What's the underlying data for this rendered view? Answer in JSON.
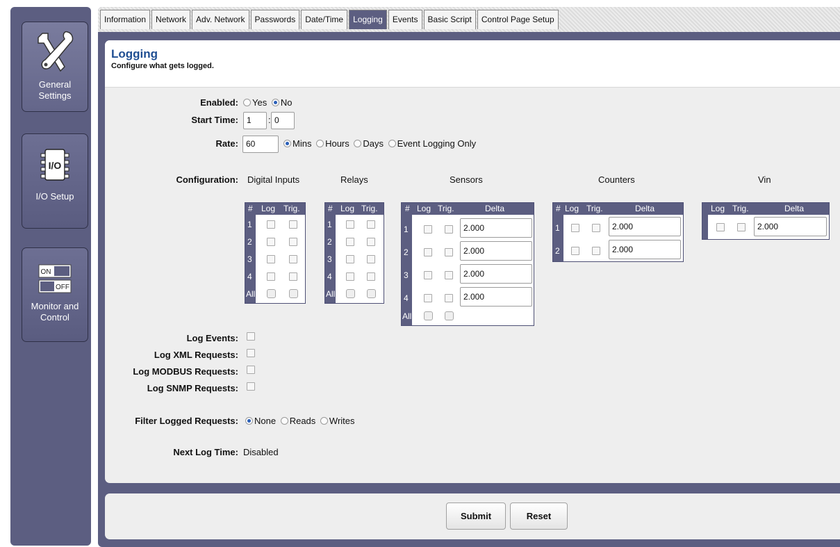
{
  "sidebar": {
    "items": [
      {
        "label_1": "General",
        "label_2": "Settings",
        "icon": "tools-icon"
      },
      {
        "label_1": "I/O Setup",
        "icon": "chip-icon",
        "chip_text": "I/O"
      },
      {
        "label_1": "Monitor and",
        "label_2": "Control",
        "icon": "switch-icon",
        "on_text": "ON",
        "off_text": "OFF"
      }
    ]
  },
  "tabs": [
    "Information",
    "Network",
    "Adv. Network",
    "Passwords",
    "Date/Time",
    "Logging",
    "Events",
    "Basic Script",
    "Control Page Setup"
  ],
  "active_tab": "Logging",
  "page": {
    "title": "Logging",
    "subtitle": "Configure what gets logged."
  },
  "form": {
    "enabled": {
      "label": "Enabled:",
      "options": [
        "Yes",
        "No"
      ],
      "selected": "No"
    },
    "start_time": {
      "label": "Start Time:",
      "hour": "1",
      "minute": "0",
      "separator": ":"
    },
    "rate": {
      "label": "Rate:",
      "value": "60",
      "options": [
        "Mins",
        "Hours",
        "Days",
        "Event Logging Only"
      ],
      "selected": "Mins"
    },
    "configuration": {
      "label": "Configuration:",
      "groups": {
        "digital_inputs": {
          "title": "Digital Inputs",
          "headers": [
            "#",
            "Log",
            "Trig."
          ],
          "rows": [
            "1",
            "2",
            "3",
            "4",
            "All"
          ]
        },
        "relays": {
          "title": "Relays",
          "headers": [
            "#",
            "Log",
            "Trig."
          ],
          "rows": [
            "1",
            "2",
            "3",
            "4",
            "All"
          ]
        },
        "sensors": {
          "title": "Sensors",
          "headers": [
            "#",
            "Log",
            "Trig.",
            "Delta"
          ],
          "rows": [
            "1",
            "2",
            "3",
            "4",
            "All"
          ],
          "deltas": [
            "2.000",
            "2.000",
            "2.000",
            "2.000"
          ]
        },
        "counters": {
          "title": "Counters",
          "headers": [
            "#",
            "Log",
            "Trig.",
            "Delta"
          ],
          "rows": [
            "1",
            "2"
          ],
          "deltas": [
            "2.000",
            "2.000"
          ]
        },
        "vin": {
          "title": "Vin",
          "headers": [
            "Log",
            "Trig.",
            "Delta"
          ],
          "deltas": [
            "2.000"
          ]
        }
      }
    },
    "log_events": {
      "label": "Log Events:"
    },
    "log_xml": {
      "label": "Log XML Requests:"
    },
    "log_modbus": {
      "label": "Log MODBUS Requests:"
    },
    "log_snmp": {
      "label": "Log SNMP Requests:"
    },
    "filter": {
      "label": "Filter Logged Requests:",
      "options": [
        "None",
        "Reads",
        "Writes"
      ],
      "selected": "None"
    },
    "next_log": {
      "label": "Next Log Time:",
      "value": "Disabled"
    }
  },
  "buttons": {
    "submit": "Submit",
    "reset": "Reset"
  }
}
